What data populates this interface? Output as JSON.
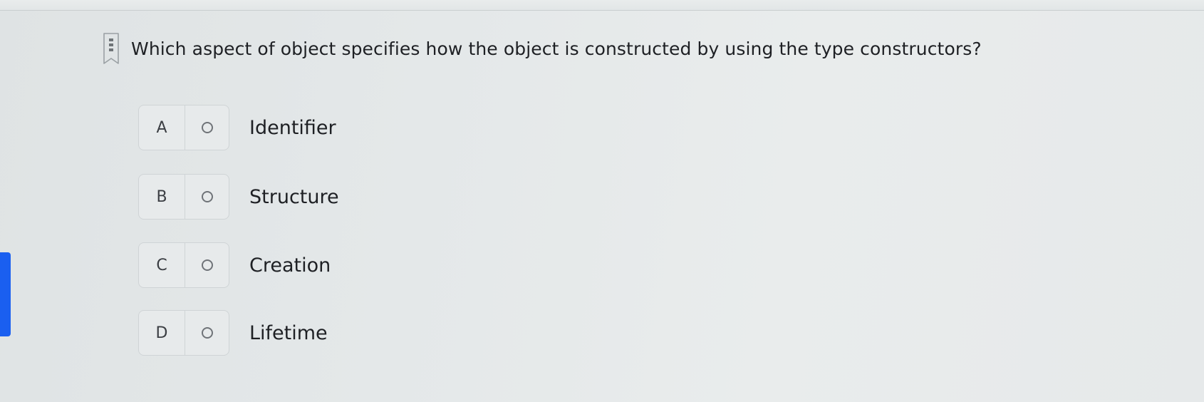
{
  "question": {
    "text": "Which aspect of object specifies how the object is constructed by using the type constructors?",
    "bookmark_icon": "bookmark-icon"
  },
  "options": [
    {
      "letter": "A",
      "text": "Identifier"
    },
    {
      "letter": "B",
      "text": "Structure"
    },
    {
      "letter": "C",
      "text": "Creation"
    },
    {
      "letter": "D",
      "text": "Lifetime"
    }
  ],
  "colors": {
    "background": "#e6e9ea",
    "accent": "#1a5ff0",
    "option_border": "#cfd4d6",
    "text": "#1e2024"
  }
}
